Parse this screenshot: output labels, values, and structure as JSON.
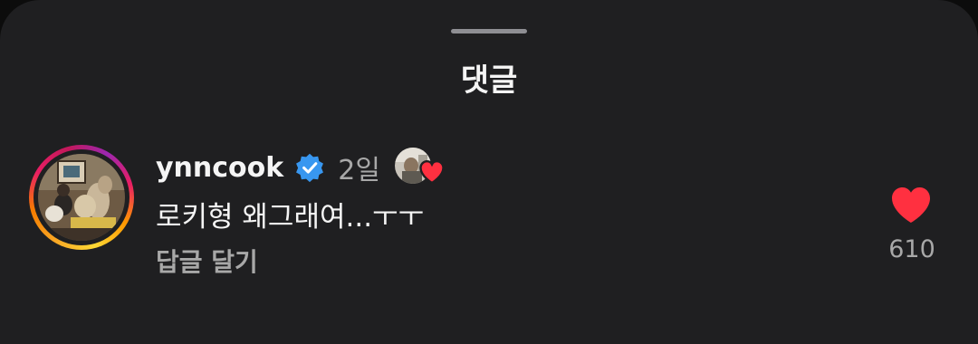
{
  "sheet": {
    "title": "댓글"
  },
  "comment": {
    "username": "ynncook",
    "verified": true,
    "time": "2일",
    "text": "로키형 왜그래여...ㅜㅜ",
    "reply_label": "답글 달기",
    "like_count": "610",
    "liked": true,
    "liked_by_author": true
  },
  "icons": {
    "verified": "verified-badge-icon",
    "heart": "heart-filled-icon",
    "author_liked_heart": "heart-filled-icon"
  },
  "colors": {
    "sheet_background": "#1f1f21",
    "primary_text": "#f5f5f5",
    "secondary_text": "#a8a8a8",
    "like_red": "#ff3040",
    "verified_blue": "#3897f0"
  }
}
